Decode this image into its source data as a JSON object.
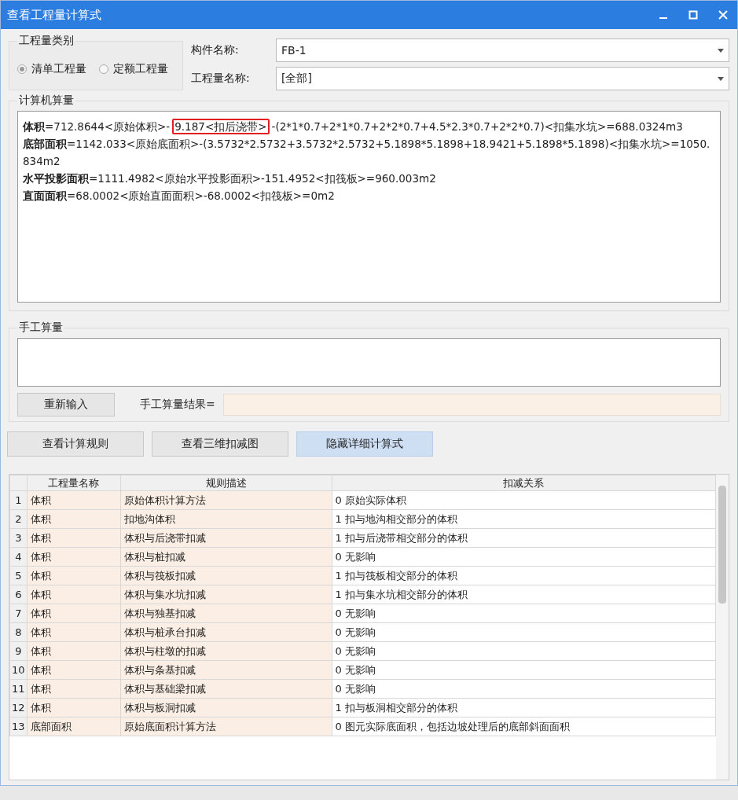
{
  "window": {
    "title": "查看工程量计算式"
  },
  "category_group": {
    "title": "工程量类别",
    "options": [
      {
        "label": "清单工程量",
        "selected": true
      },
      {
        "label": "定额工程量",
        "selected": false
      }
    ]
  },
  "fields": [
    {
      "label": "构件名称:",
      "value": "FB-1"
    },
    {
      "label": "工程量名称:",
      "value": "[全部]"
    }
  ],
  "computer_calc": {
    "title": "计算机算量",
    "lines": [
      {
        "label": "体积",
        "segments": [
          {
            "kind": "plain",
            "text": "=712.8644<原始体积>-"
          },
          {
            "kind": "boxed",
            "text": "9.187<扣后浇带>"
          },
          {
            "kind": "plain",
            "text": "-(2*1*0.7+2*1*0.7+2*2*0.7+4.5*2.3*0.7+2*2*0.7)<扣集水坑>=688.0324m3"
          }
        ]
      },
      {
        "label": "底部面积",
        "segments": [
          {
            "kind": "plain",
            "text": "=1142.033<原始底面积>-(3.5732*2.5732+3.5732*2.5732+5.1898*5.1898+18.9421+5.1898*5.1898)<扣集水坑>=1050.834m2"
          }
        ]
      },
      {
        "label": "水平投影面积",
        "segments": [
          {
            "kind": "plain",
            "text": "=1111.4982<原始水平投影面积>-151.4952<扣筏板>=960.003m2"
          }
        ]
      },
      {
        "label": "直面面积",
        "segments": [
          {
            "kind": "plain",
            "text": "=68.0002<原始直面面积>-68.0002<扣筏板>=0m2"
          }
        ]
      }
    ]
  },
  "manual_calc": {
    "title": "手工算量",
    "reenter_button": "重新输入",
    "result_label": "手工算量结果="
  },
  "buttons": [
    {
      "label": "查看计算规则",
      "selected": false
    },
    {
      "label": "查看三维扣减图",
      "selected": false
    },
    {
      "label": "隐藏详细计算式",
      "selected": true
    }
  ],
  "table": {
    "columns": [
      "",
      "工程量名称",
      "规则描述",
      "扣减关系"
    ],
    "rows": [
      [
        "1",
        "体积",
        "原始体积计算方法",
        "0 原始实际体积"
      ],
      [
        "2",
        "体积",
        "扣地沟体积",
        "1 扣与地沟相交部分的体积"
      ],
      [
        "3",
        "体积",
        "体积与后浇带扣减",
        "1 扣与后浇带相交部分的体积"
      ],
      [
        "4",
        "体积",
        "体积与桩扣减",
        "0  无影响"
      ],
      [
        "5",
        "体积",
        "体积与筏板扣减",
        "1 扣与筏板相交部分的体积"
      ],
      [
        "6",
        "体积",
        "体积与集水坑扣减",
        "1 扣与集水坑相交部分的体积"
      ],
      [
        "7",
        "体积",
        "体积与独基扣减",
        "0  无影响"
      ],
      [
        "8",
        "体积",
        "体积与桩承台扣减",
        "0  无影响"
      ],
      [
        "9",
        "体积",
        "体积与柱墩的扣减",
        "0  无影响"
      ],
      [
        "10",
        "体积",
        "体积与条基扣减",
        "0  无影响"
      ],
      [
        "11",
        "体积",
        "体积与基础梁扣减",
        "0  无影响"
      ],
      [
        "12",
        "体积",
        "体积与板洞扣减",
        "1 扣与板洞相交部分的体积"
      ],
      [
        "13",
        "底部面积",
        "原始底面积计算方法",
        "0 图元实际底面积，包括边坡处理后的底部斜面面积"
      ]
    ]
  }
}
